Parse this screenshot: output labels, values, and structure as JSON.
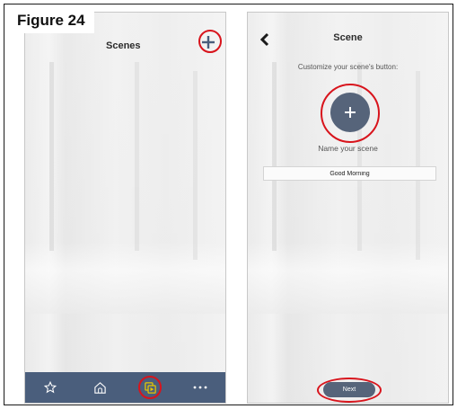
{
  "figure": {
    "label": "Figure 24"
  },
  "scenes_screen": {
    "title": "Scenes",
    "nav": [
      {
        "name": "favorites",
        "icon": "star-outline-icon"
      },
      {
        "name": "home",
        "icon": "house-outline-icon"
      },
      {
        "name": "scenes",
        "icon": "scenes-icon",
        "selected": true
      },
      {
        "name": "more",
        "icon": "more-dots-icon"
      }
    ],
    "nav_color": "#4a5e7c",
    "selected_color": "#e8c800"
  },
  "scene_screen": {
    "title": "Scene",
    "customize_label": "Customize your scene's button:",
    "name_label": "Name your scene",
    "name_value": "Good Morning",
    "next_label": "Next",
    "button_color": "#56647a"
  },
  "highlight_color": "#d8141c"
}
